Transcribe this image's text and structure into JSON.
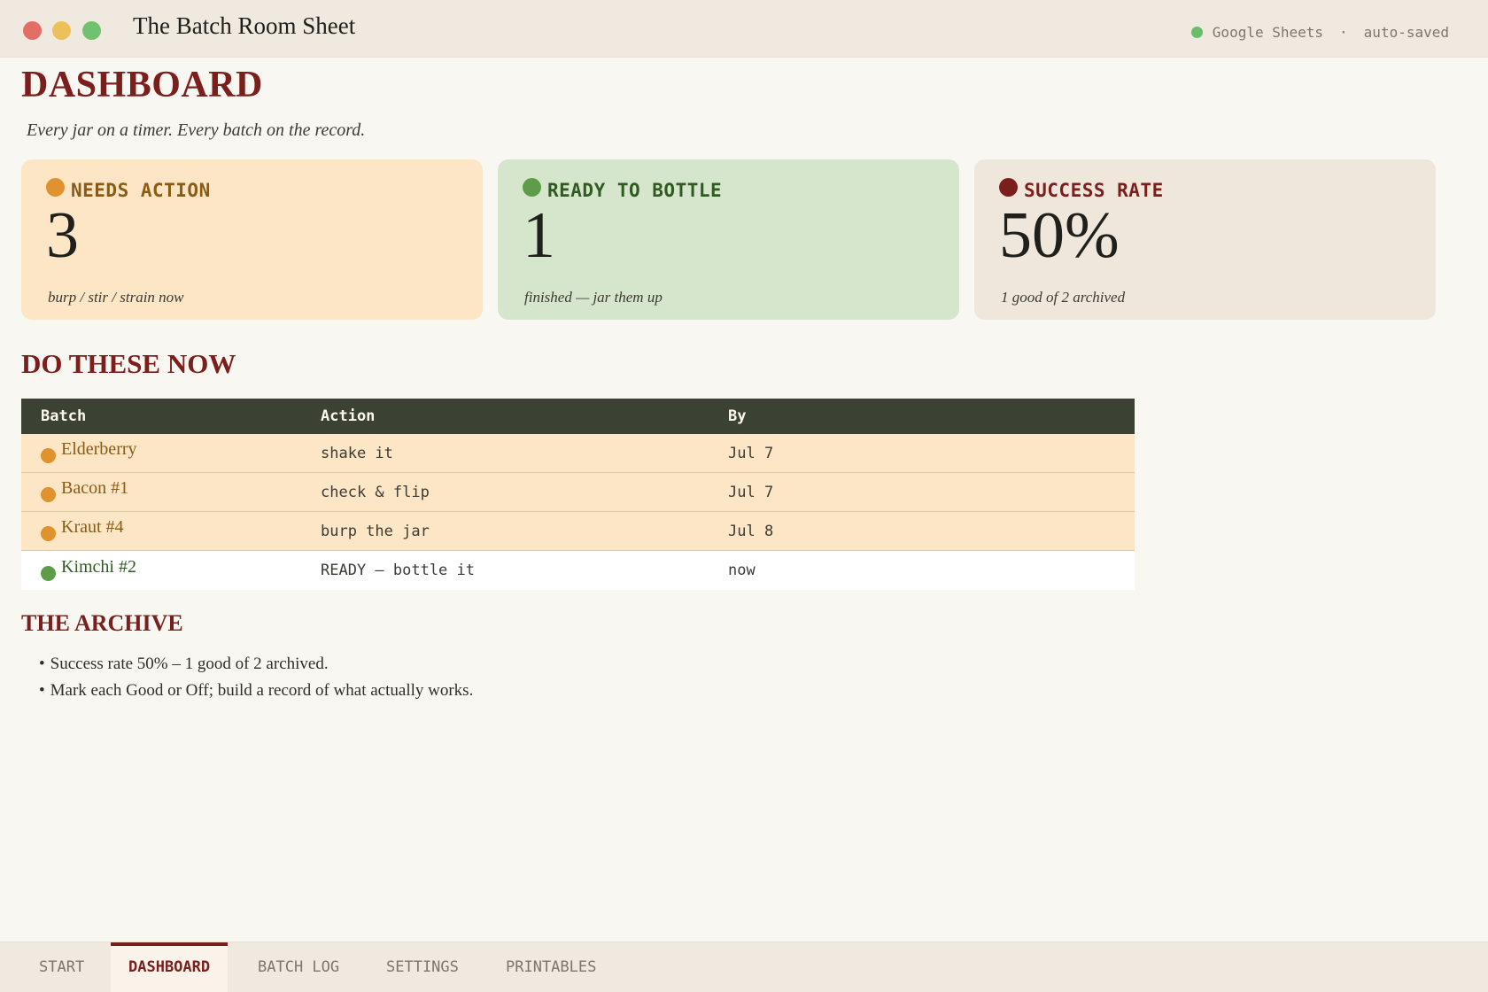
{
  "window": {
    "title": "The Batch Room Sheet",
    "app_name": "Google Sheets",
    "separator": "·",
    "save_status": "auto-saved",
    "status_color": "#6cbd6b"
  },
  "dashboard": {
    "title": "DASHBOARD",
    "tagline": "Every jar on a timer. Every batch on the record."
  },
  "cards": {
    "needs_action": {
      "label": "NEEDS ACTION",
      "value": "3",
      "note": "burp / stir / strain now",
      "color": "#e0922f",
      "label_color": "#8a5b14"
    },
    "ready": {
      "label": "READY TO BOTTLE",
      "value": "1",
      "note": "finished — jar them up",
      "color": "#5f9c49",
      "label_color": "#2f5b22"
    },
    "success": {
      "label": "SUCCESS RATE",
      "value": "50%",
      "note": "1 good of 2 archived",
      "color": "#7b1f1c",
      "label_color": "#7b1f1c"
    }
  },
  "do_now": {
    "title": "DO THESE NOW",
    "columns": [
      "Batch",
      "Action",
      "By"
    ],
    "rows": [
      {
        "batch": "Elderberry",
        "action": "shake it",
        "by": "Jul 7",
        "status": "action"
      },
      {
        "batch": "Bacon #1",
        "action": "check & flip",
        "by": "Jul 7",
        "status": "action"
      },
      {
        "batch": "Kraut #4",
        "action": "burp the jar",
        "by": "Jul 8",
        "status": "action"
      },
      {
        "batch": "Kimchi #2",
        "action": "READY — bottle it",
        "by": "now",
        "status": "ready"
      }
    ]
  },
  "archive": {
    "title": "THE ARCHIVE",
    "items": [
      "Success rate 50% – 1 good of 2 archived.",
      "Mark each Good or Off; build a record of what actually works."
    ]
  },
  "tabs": [
    "START",
    "DASHBOARD",
    "BATCH LOG",
    "SETTINGS",
    "PRINTABLES"
  ],
  "active_tab": "DASHBOARD"
}
